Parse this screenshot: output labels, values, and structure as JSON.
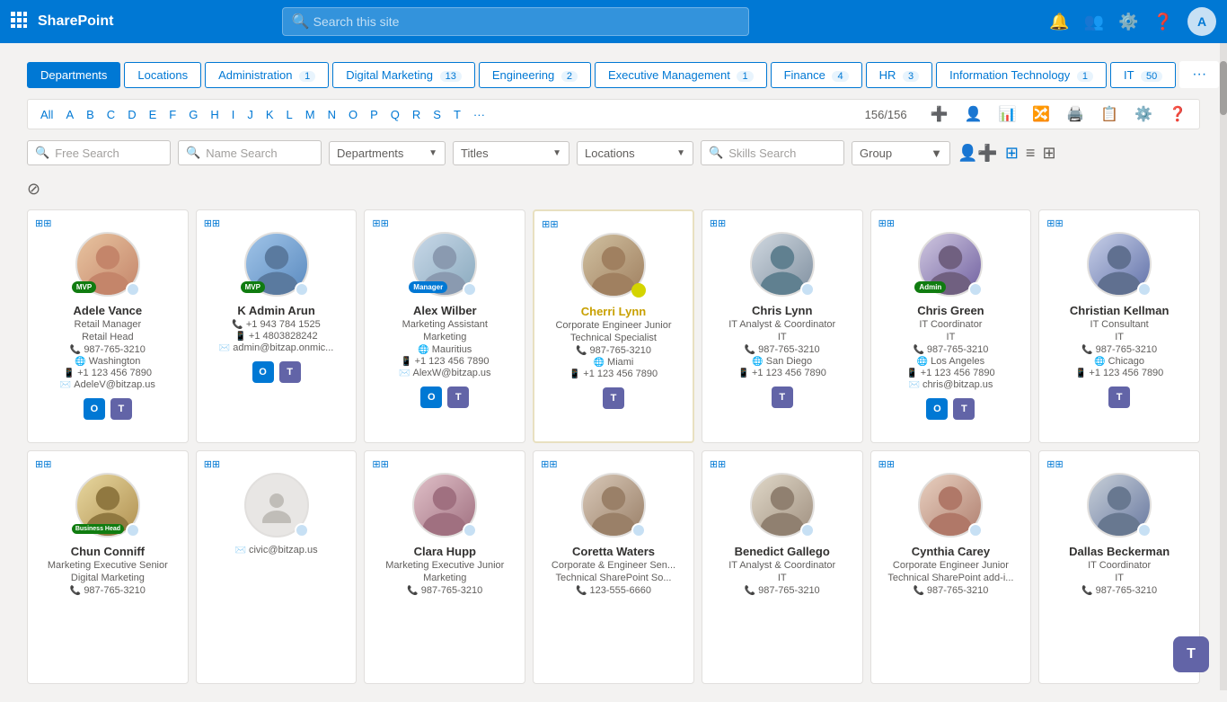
{
  "topnav": {
    "logo": "SharePoint",
    "search_placeholder": "Search this site"
  },
  "dept_tabs": [
    {
      "label": "Departments",
      "active": true,
      "badge": ""
    },
    {
      "label": "Locations",
      "active": false,
      "badge": ""
    },
    {
      "label": "Administration",
      "active": false,
      "badge": "1"
    },
    {
      "label": "Digital Marketing",
      "active": false,
      "badge": "13"
    },
    {
      "label": "Engineering",
      "active": false,
      "badge": "2"
    },
    {
      "label": "Executive Management",
      "active": false,
      "badge": "1"
    },
    {
      "label": "Finance",
      "active": false,
      "badge": "4"
    },
    {
      "label": "HR",
      "active": false,
      "badge": "3"
    },
    {
      "label": "Information Technology",
      "active": false,
      "badge": "1"
    },
    {
      "label": "IT",
      "active": false,
      "badge": "50"
    },
    {
      "label": "...",
      "active": false,
      "badge": ""
    }
  ],
  "alpha_bar": {
    "letters": [
      "All",
      "A",
      "B",
      "C",
      "D",
      "E",
      "F",
      "G",
      "H",
      "I",
      "J",
      "K",
      "L",
      "M",
      "N",
      "O",
      "P",
      "Q",
      "R",
      "S",
      "T",
      "···"
    ],
    "count": "156/156"
  },
  "search_bar": {
    "free_search_placeholder": "Free Search",
    "name_search_placeholder": "Name Search",
    "departments_label": "Departments",
    "titles_label": "Titles",
    "locations_label": "Locations",
    "skills_search_placeholder": "Skills Search",
    "group_label": "Group"
  },
  "people": [
    {
      "name": "Adele Vance",
      "title": "Retail Manager",
      "title2": "Retail Head",
      "phone": "987-765-3210",
      "location": "Washington",
      "mobile": "+1 123 456 7890",
      "email": "AdeleV@bitzap.us",
      "badge": "MVP",
      "badge_class": "mvp",
      "highlighted": false,
      "apps": [
        "outlook",
        "teams"
      ]
    },
    {
      "name": "K Admin Arun",
      "title": "",
      "title2": "",
      "phone": "+1 943 784 1525",
      "phone2": "+1 4803828242",
      "email": "admin@bitzap.onmic...",
      "badge": "MVP",
      "badge_class": "mvp",
      "highlighted": false,
      "apps": [
        "outlook",
        "teams"
      ]
    },
    {
      "name": "Alex Wilber",
      "title": "Marketing Assistant",
      "title2": "Marketing",
      "phone": "",
      "location": "Mauritius",
      "mobile": "+1 123 456 7890",
      "email": "AlexW@bitzap.us",
      "badge": "Manager",
      "badge_class": "manager",
      "highlighted": false,
      "apps": [
        "outlook",
        "teams"
      ]
    },
    {
      "name": "Cherri Lynn",
      "title": "Corporate & Engineer Junior",
      "title2": "Technical Specialist",
      "phone": "987-765-3210",
      "location": "Miami",
      "mobile": "+1 123 456 7890",
      "badge": "",
      "badge_class": "",
      "highlighted": true,
      "apps": [
        "teams"
      ]
    },
    {
      "name": "Chris Lynn",
      "title": "IT Analyst & Coordinator",
      "title2": "IT",
      "phone": "987-765-3210",
      "location": "San Diego",
      "mobile": "+1 123 456 7890",
      "badge": "",
      "badge_class": "",
      "highlighted": false,
      "apps": [
        "teams"
      ]
    },
    {
      "name": "Chris Green",
      "title": "IT Coordinator",
      "title2": "IT",
      "phone": "987-765-3210",
      "location": "Los Angeles",
      "mobile": "+1 123 456 7890",
      "email": "chris@bitzap.us",
      "badge": "Admin",
      "badge_class": "admin",
      "highlighted": false,
      "apps": [
        "outlook",
        "teams"
      ]
    },
    {
      "name": "Christian Kellman",
      "title": "IT Consultant",
      "title2": "IT",
      "phone": "987-765-3210",
      "location": "Chicago",
      "mobile": "+1 123 456 7890",
      "badge": "",
      "badge_class": "",
      "highlighted": false,
      "apps": [
        "teams"
      ]
    },
    {
      "name": "Chun Conniff",
      "title": "Marketing Executive Senior",
      "title2": "Digital Marketing",
      "phone": "987-765-3210",
      "location": "",
      "mobile": "",
      "email": "",
      "badge": "Business Head",
      "badge_class": "biz",
      "highlighted": false,
      "apps": []
    },
    {
      "name": "",
      "title": "",
      "title2": "",
      "phone": "",
      "location": "",
      "mobile": "",
      "email": "civic@bitzap.us",
      "badge": "",
      "badge_class": "",
      "highlighted": false,
      "apps": [],
      "no_photo": true
    },
    {
      "name": "Clara Hupp",
      "title": "Marketing Executive Junior",
      "title2": "Marketing",
      "phone": "987-765-3210",
      "location": "",
      "mobile": "",
      "badge": "",
      "badge_class": "",
      "highlighted": false,
      "apps": []
    },
    {
      "name": "Coretta Waters",
      "title": "Corporate & Engineer Sen...",
      "title2": "Technical SharePoint So...",
      "phone": "123-555-6660",
      "location": "",
      "mobile": "",
      "badge": "",
      "badge_class": "",
      "highlighted": false,
      "apps": []
    },
    {
      "name": "Benedict Gallego",
      "title": "IT Analyst & Coordinator",
      "title2": "IT",
      "phone": "987-765-3210",
      "location": "",
      "mobile": "",
      "badge": "",
      "badge_class": "",
      "highlighted": false,
      "apps": []
    },
    {
      "name": "Cynthia Carey",
      "title": "Corporate Engineer Junior",
      "title2": "Technical SharePoint add-i...",
      "phone": "987-765-3210",
      "location": "",
      "mobile": "",
      "badge": "",
      "badge_class": "",
      "highlighted": false,
      "apps": []
    },
    {
      "name": "Dallas Beckerman",
      "title": "IT Coordinator",
      "title2": "IT",
      "phone": "987-765-3210",
      "location": "",
      "mobile": "",
      "badge": "",
      "badge_class": "",
      "highlighted": false,
      "apps": []
    }
  ]
}
